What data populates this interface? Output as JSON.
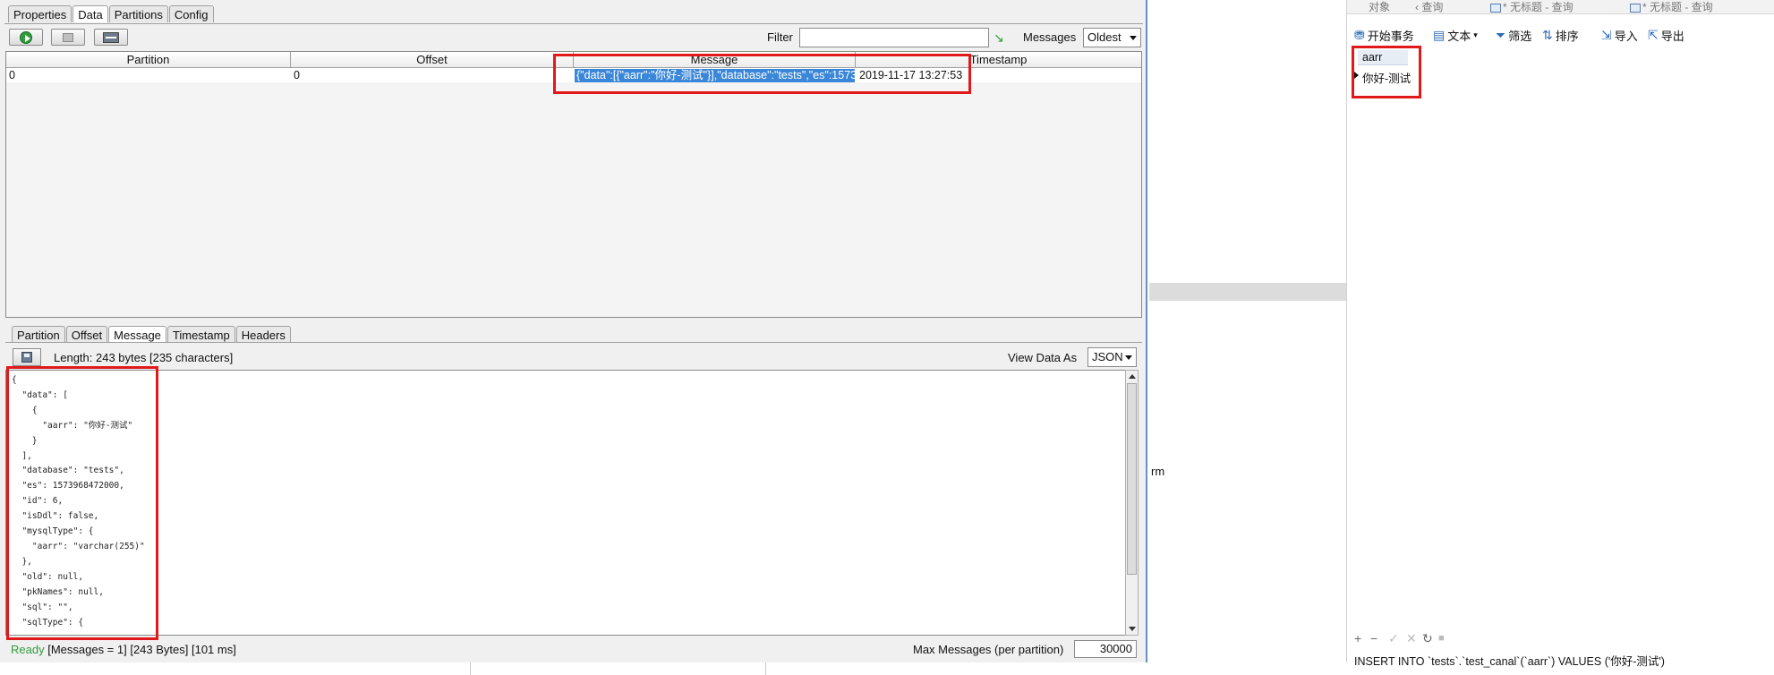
{
  "kafka": {
    "top_tabs": [
      "Properties",
      "Data",
      "Partitions",
      "Config"
    ],
    "filter_label": "Filter",
    "filter_value": "",
    "messages_label": "Messages",
    "messages_select": "Oldest",
    "columns": [
      "Partition",
      "Offset",
      "Message",
      "Timestamp"
    ],
    "row": {
      "partition": "0",
      "offset": "0",
      "message": "{\"data\":[{\"aarr\":\"你好-测试\"}],\"database\":\"tests\",\"es\":1573...",
      "timestamp": "2019-11-17 13:27:53"
    },
    "sub_tabs": [
      "Partition",
      "Offset",
      "Message",
      "Timestamp",
      "Headers"
    ],
    "length_text": "Length: 243 bytes [235 characters]",
    "view_as_label": "View Data As",
    "view_as_select": "JSON",
    "json_text": "{\n  \"data\": [\n    {\n      \"aarr\": \"你好-测试\"\n    }\n  ],\n  \"database\": \"tests\",\n  \"es\": 1573968472000,\n  \"id\": 6,\n  \"isDdl\": false,\n  \"mysqlType\": {\n    \"aarr\": \"varchar(255)\"\n  },\n  \"old\": null,\n  \"pkNames\": null,\n  \"sql\": \"\",\n  \"sqlType\": {",
    "status": {
      "ready": "Ready",
      "info": "[Messages = 1]  [243 Bytes]  [101 ms]"
    },
    "max_messages_label": "Max Messages (per partition)",
    "max_messages_value": "30000"
  },
  "middle": {
    "partial_text": "rm"
  },
  "navicat": {
    "tabs": [
      "对象",
      "查询",
      "* 无标题 - 查询",
      "* 无标题 - 查询"
    ],
    "toolbar": {
      "begin_tx": "开始事务",
      "text": "文本",
      "filter": "筛选",
      "sort": "排序",
      "import": "导入",
      "export": "导出"
    },
    "column": "aarr",
    "value": "你好-测试",
    "bottom_buttons": [
      "+",
      "−",
      "✓",
      "✕",
      "↻",
      "■"
    ],
    "sql": "INSERT INTO `tests`.`test_canal`(`aarr`) VALUES ('你好-测试')"
  },
  "colors": {
    "highlight": "#e01a1a",
    "selection": "#3a86d8",
    "ready": "#2f9d3a"
  }
}
